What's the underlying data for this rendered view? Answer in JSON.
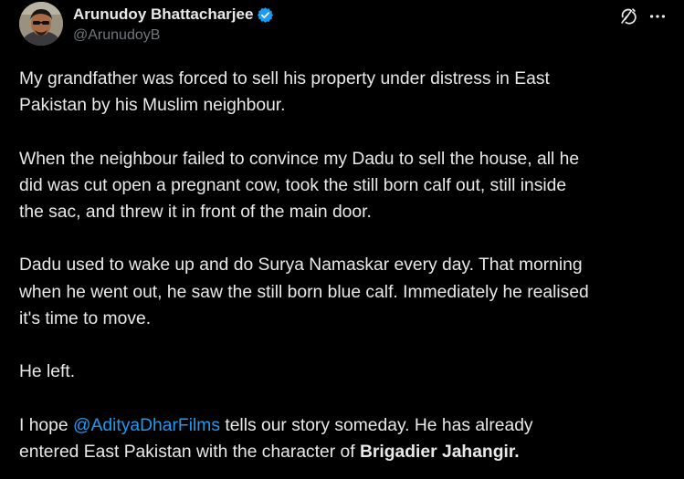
{
  "author": {
    "display_name": "Arunudoy Bhattacharjee",
    "handle": "@ArunudoyB",
    "verified": true
  },
  "icons": {
    "avatar": "avatar",
    "verified": "verified-badge-icon",
    "grok": "grok-icon",
    "more": "more-options-icon"
  },
  "colors": {
    "background": "#000000",
    "text": "#e7e9ea",
    "secondary_text": "#71767b",
    "link": "#1d9bf0",
    "verified": "#1d9bf0"
  },
  "post": {
    "paragraph_1": "My grandfather was forced to sell his property under distress in East\nPakistan by his Muslim neighbour.",
    "paragraph_2": "When the neighbour failed to convince my Dadu to sell the house, all he\ndid was cut open a pregnant cow, took the still born calf out, still inside\nthe sac, and threw it in front of the main door.",
    "paragraph_3": "Dadu used to wake up and do Surya Namaskar every day. That morning\nwhen he went out, he saw the still born blue calf. Immediately he realised\nit's time to move.",
    "paragraph_4": "He left.",
    "paragraph_5_prefix": "I hope ",
    "paragraph_5_mention": "@AdityaDharFilms",
    "paragraph_5_middle": " tells our story someday. He has already",
    "paragraph_5_line2": "entered East Pakistan with the character of ",
    "paragraph_5_bold": "Brigadier Jahangir."
  }
}
